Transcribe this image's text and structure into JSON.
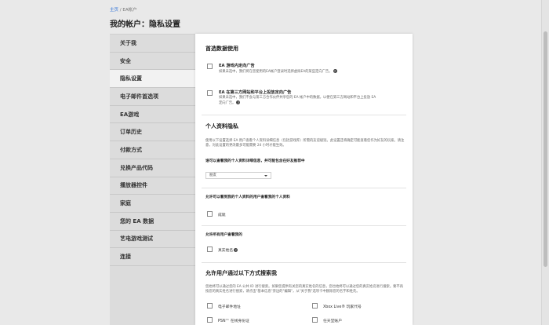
{
  "breadcrumb": {
    "home": "主页",
    "sep": " / ",
    "current": "EA帐户"
  },
  "page_title": "我的帐户：隐私设置",
  "sidebar": {
    "items": [
      {
        "label": "关于我"
      },
      {
        "label": "安全"
      },
      {
        "label": "隐私设置",
        "active": true
      },
      {
        "label": "电子邮件首选项"
      },
      {
        "label": "EA游戏"
      },
      {
        "label": "订单历史"
      },
      {
        "label": "付款方式"
      },
      {
        "label": "兑换产品代码"
      },
      {
        "label": "播放器控件"
      },
      {
        "label": "家庭"
      },
      {
        "label": "您的 EA 数据"
      },
      {
        "label": "艺电游戏测试"
      },
      {
        "label": "连接"
      }
    ]
  },
  "main": {
    "data_usage": {
      "title": "首选数据使用",
      "in_game_ads": {
        "title": "EA 游戏内定向广告",
        "desc": "如果未选中，我们将在您使用的EA帐户登录时选择虚拟EA的某些定向广告。"
      },
      "third_party_ads": {
        "title": "EA 在第三方网站和平台上投放定向广告",
        "desc": "如果未选中，我们不会与第三方合作伙伴共享您的 EA 帐户中的数据，以便在第三方网站和平台上投放 EA 定向广告。"
      }
    },
    "profile_privacy": {
      "title": "个人资料隐私",
      "desc": "使用以下设置选择 EA 用户查看个人资料详细信息（包括游戏库）所需的友谊级别。此设置还将确定可能查看您作为好友的玩家。请注意，对此设置的更改最多可能需要 24 小时才能生效。",
      "who_can_view_q": "谁可以查看我的个人资料详细信息，并可能包含在好友推荐中",
      "who_can_view_value": "朋友",
      "allow_friends_q": "允许可以看到我的个人资料的用户查看我的个人资料",
      "allow_friends_label": "成就",
      "allow_all_q": "允许所有用户查看我的",
      "allow_all_label": "真实姓名"
    },
    "search": {
      "title": "允许用户通过以下方式搜索我",
      "desc": "您始终可以通过您的 EA 公共 ID 进行搜索。如果您提供有关您的真实姓名的信息，您也始终可以通过您的真实姓名进行搜索。要不再按您的真实姓名进行搜索，请点击\"基本信息\"旁边的\"编辑\"，从\"关于我\"选项卡中删除您的名字和姓氏。",
      "options": {
        "email": "电子邮件地址",
        "xbox": "Xbox Live® 玩家代号",
        "psn": "PSN™ 在线身份证",
        "nintendo": "任天堂账户"
      }
    }
  }
}
